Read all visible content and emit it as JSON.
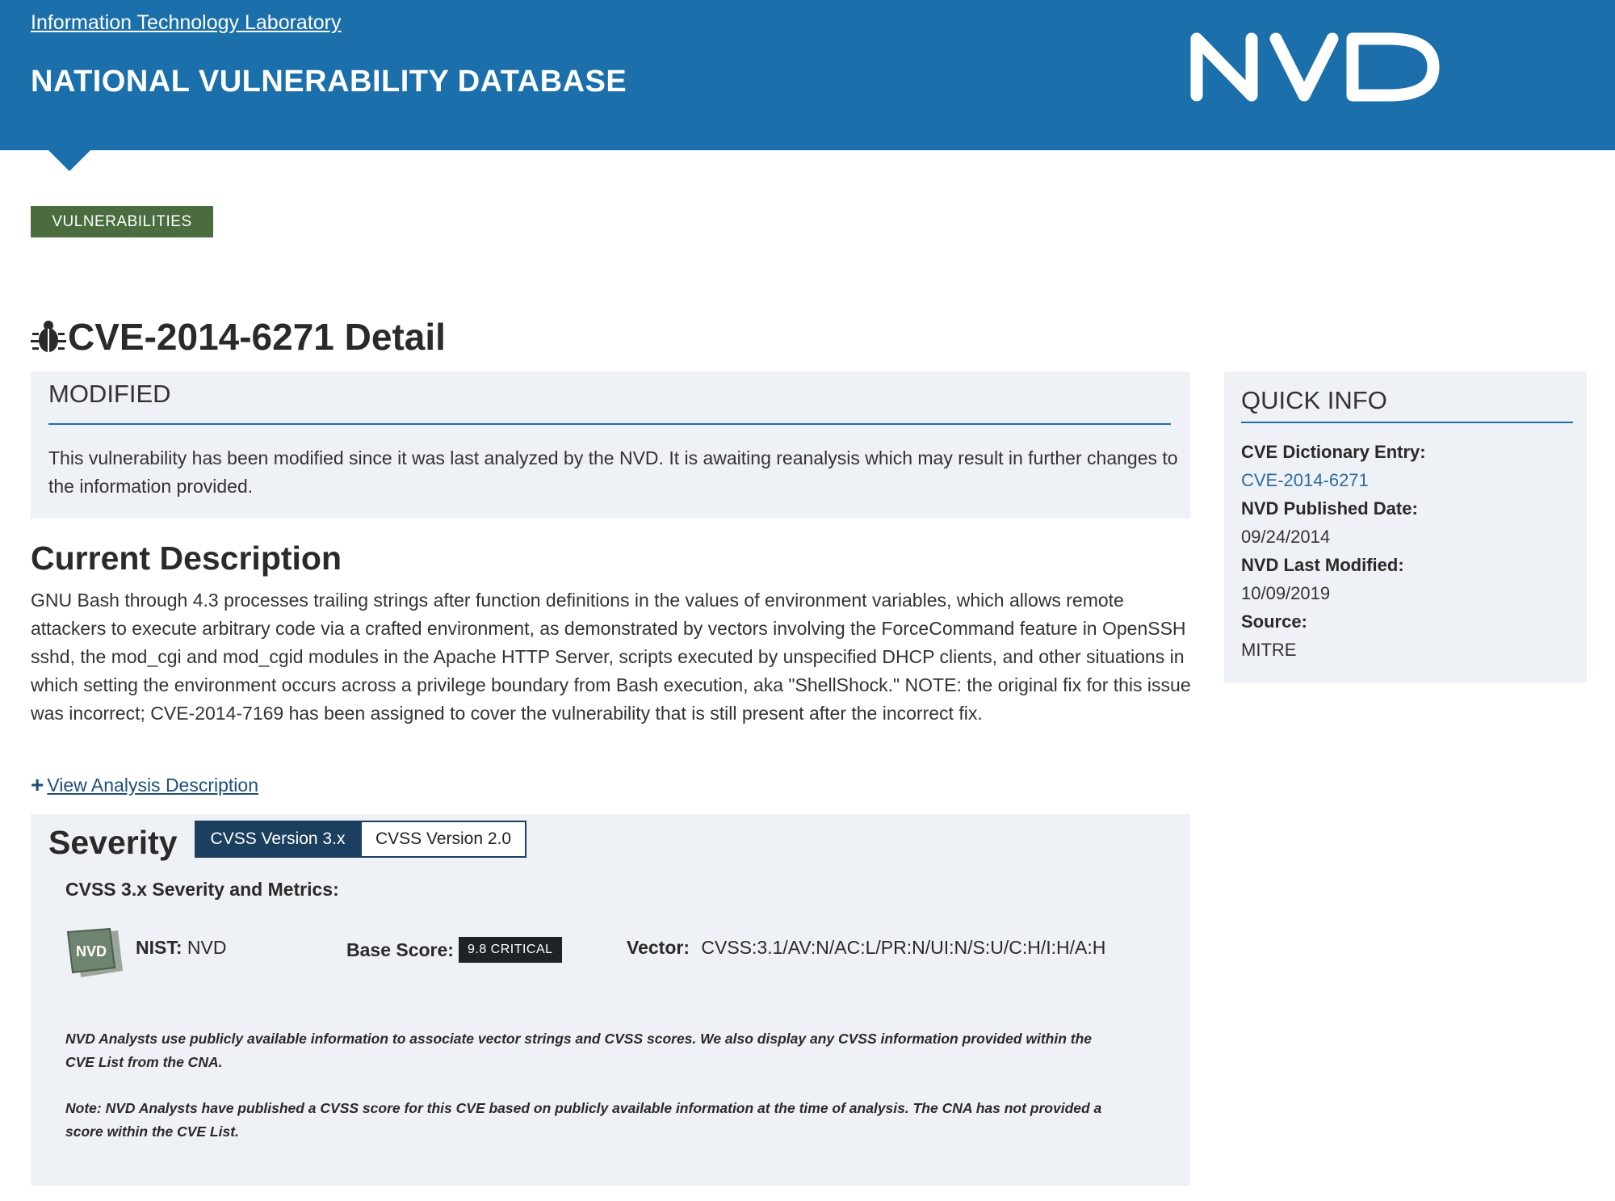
{
  "header": {
    "itl_link": "Information Technology Laboratory",
    "site_title": "NATIONAL VULNERABILITY DATABASE",
    "logo_text": "NVD",
    "bg_color": "#1b6faa"
  },
  "breadcrumb": {
    "label": "VULNERABILITIES",
    "bg_color": "#4a6c3f"
  },
  "page": {
    "title": "CVE-2014-6271 Detail",
    "title_icon": "bug-icon"
  },
  "modified": {
    "title": "MODIFIED",
    "text": "This vulnerability has been modified since it was last analyzed by the NVD. It is awaiting reanalysis which may result in further changes to the information provided."
  },
  "description": {
    "heading": "Current Description",
    "text": "GNU Bash through 4.3 processes trailing strings after function definitions in the values of environment variables, which allows remote attackers to execute arbitrary code via a crafted environment, as demonstrated by vectors involving the ForceCommand feature in OpenSSH sshd, the mod_cgi and mod_cgid modules in the Apache HTTP Server, scripts executed by unspecified DHCP clients, and other situations in which setting the environment occurs across a privilege boundary from Bash execution, aka \"ShellShock.\" NOTE: the original fix for this issue was incorrect; CVE-2014-7169 has been assigned to cover the vulnerability that is still present after the incorrect fix.",
    "view_analysis_label": "View Analysis Description",
    "view_analysis_icon": "plus-icon"
  },
  "severity": {
    "title": "Severity",
    "tabs": [
      {
        "label": "CVSS Version 3.x",
        "active": true
      },
      {
        "label": "CVSS Version 2.0",
        "active": false
      }
    ],
    "metrics_heading": "CVSS 3.x Severity and Metrics:",
    "badge_text": "NVD",
    "nist_label": "NIST:",
    "nist_value": "NVD",
    "base_score_label": "Base Score:",
    "base_score_value": "9.8 CRITICAL",
    "vector_label": "Vector:",
    "vector_value": "CVSS:3.1/AV:N/AC:L/PR:N/UI:N/S:U/C:H/I:H/A:H",
    "note_1": "NVD Analysts use publicly available information to associate vector strings and CVSS scores. We also display any CVSS information provided within the CVE List from the CNA.",
    "note_2": "Note: NVD Analysts have published a CVSS score for this CVE based on publicly available information at the time of analysis. The CNA has not provided a score within the CVE List.",
    "active_tab_color": "#1b3f5e",
    "score_badge_color": "#1e2328"
  },
  "quick_info": {
    "title": "QUICK INFO",
    "dictionary_label": "CVE Dictionary Entry:",
    "dictionary_value": "CVE-2014-6271",
    "published_label": "NVD Published Date:",
    "published_value": "09/24/2014",
    "modified_label": "NVD Last Modified:",
    "modified_value": "10/09/2019",
    "source_label": "Source:",
    "source_value": "MITRE"
  }
}
